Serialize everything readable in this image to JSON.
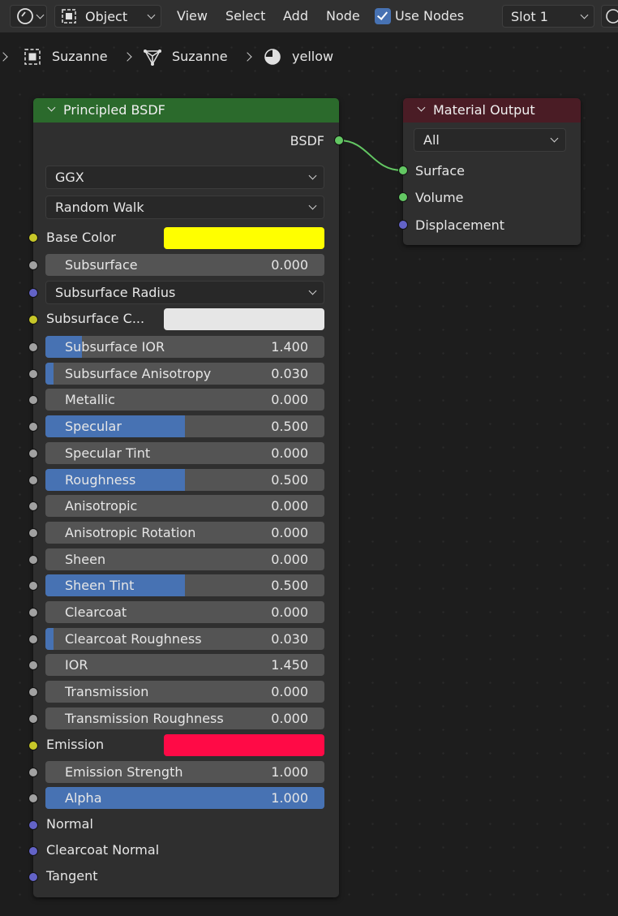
{
  "header": {
    "mode_label": "Object",
    "menu": [
      "View",
      "Select",
      "Add",
      "Node"
    ],
    "use_nodes_label": "Use Nodes",
    "use_nodes_checked": true,
    "slot_label": "Slot 1"
  },
  "breadcrumb": {
    "object": "Suzanne",
    "mesh": "Suzanne",
    "material": "yellow"
  },
  "bsdf_node": {
    "title": "Principled BSDF",
    "header_color": "#2b6a2c",
    "output_label": "BSDF",
    "distribution": "GGX",
    "subsurface_method": "Random Walk",
    "base_color_label": "Base Color",
    "base_color": "#ffff00",
    "subsurface_label": "Subsurface",
    "subsurface_value": "0.000",
    "subsurface_radius_label": "Subsurface Radius",
    "subsurface_color_label": "Subsurface C...",
    "subsurface_color": "#e6e6e6",
    "sliders": [
      {
        "label": "Subsurface IOR",
        "value": "1.400",
        "fill": 0.13
      },
      {
        "label": "Subsurface Anisotropy",
        "value": "0.030",
        "fill": 0.03
      },
      {
        "label": "Metallic",
        "value": "0.000",
        "fill": 0
      },
      {
        "label": "Specular",
        "value": "0.500",
        "fill": 0.5
      },
      {
        "label": "Specular Tint",
        "value": "0.000",
        "fill": 0
      },
      {
        "label": "Roughness",
        "value": "0.500",
        "fill": 0.5
      },
      {
        "label": "Anisotropic",
        "value": "0.000",
        "fill": 0
      },
      {
        "label": "Anisotropic Rotation",
        "value": "0.000",
        "fill": 0
      },
      {
        "label": "Sheen",
        "value": "0.000",
        "fill": 0
      },
      {
        "label": "Sheen Tint",
        "value": "0.500",
        "fill": 0.5
      },
      {
        "label": "Clearcoat",
        "value": "0.000",
        "fill": 0
      },
      {
        "label": "Clearcoat Roughness",
        "value": "0.030",
        "fill": 0.03
      },
      {
        "label": "IOR",
        "value": "1.450",
        "fill": 0
      },
      {
        "label": "Transmission",
        "value": "0.000",
        "fill": 0
      },
      {
        "label": "Transmission Roughness",
        "value": "0.000",
        "fill": 0
      }
    ],
    "emission_label": "Emission",
    "emission_color": "#ff0a46",
    "emission_strength_label": "Emission Strength",
    "emission_strength_value": "1.000",
    "alpha_label": "Alpha",
    "alpha_value": "1.000",
    "alpha_fill": 1.0,
    "normal_label": "Normal",
    "clearcoat_normal_label": "Clearcoat Normal",
    "tangent_label": "Tangent"
  },
  "output_node": {
    "title": "Material Output",
    "header_color": "#4a1c25",
    "target": "All",
    "surface_label": "Surface",
    "volume_label": "Volume",
    "displacement_label": "Displacement"
  },
  "colors": {
    "socket_shader": "#63c763",
    "socket_float": "#a1a1a1",
    "socket_vector": "#6363c7",
    "socket_color": "#c7c729",
    "slider_fill": "#4772b3"
  }
}
